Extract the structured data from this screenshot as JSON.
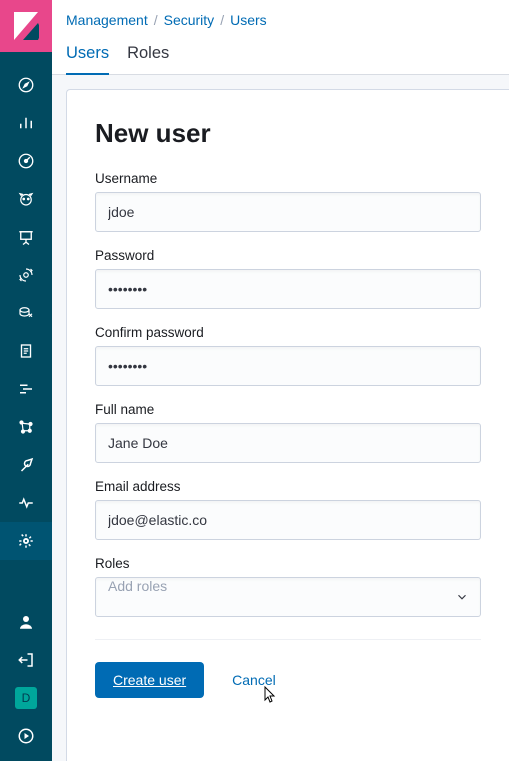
{
  "breadcrumbs": {
    "management": "Management",
    "security": "Security",
    "users": "Users"
  },
  "tabs": {
    "users": "Users",
    "roles": "Roles"
  },
  "page": {
    "title": "New user"
  },
  "form": {
    "username_label": "Username",
    "username_value": "jdoe",
    "password_label": "Password",
    "password_value": "••••••••",
    "confirm_label": "Confirm password",
    "confirm_value": "••••••••",
    "fullname_label": "Full name",
    "fullname_value": "Jane Doe",
    "email_label": "Email address",
    "email_value": "jdoe@elastic.co",
    "roles_label": "Roles",
    "roles_placeholder": "Add roles"
  },
  "buttons": {
    "create": "Create user",
    "cancel": "Cancel"
  },
  "profile_initial": "D"
}
